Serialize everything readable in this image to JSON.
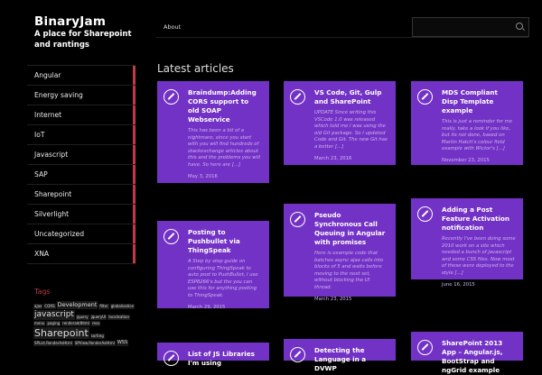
{
  "site": {
    "title": "BinaryJam",
    "tagline": "A place for Sharepoint and rantings"
  },
  "categories": [
    "Angular",
    "Energy saving",
    "Internet",
    "IoT",
    "Javascript",
    "SAP",
    "Sharepoint",
    "Silverlight",
    "Uncategorized",
    "XNA"
  ],
  "tags": {
    "heading": "Tags",
    "items": [
      {
        "label": "ajax",
        "size": "t1"
      },
      {
        "label": "CORS",
        "size": "t1"
      },
      {
        "label": "Development",
        "size": "t2"
      },
      {
        "label": "filter",
        "size": "t1"
      },
      {
        "label": "globalisation",
        "size": "t1"
      },
      {
        "label": "javascript",
        "size": "t3"
      },
      {
        "label": "jquery",
        "size": "t1"
      },
      {
        "label": "jqueryUI",
        "size": "t1"
      },
      {
        "label": "localisation",
        "size": "t1"
      },
      {
        "label": "menu",
        "size": "t1"
      },
      {
        "label": "paging",
        "size": "t1"
      },
      {
        "label": "renderaddhtml",
        "size": "t1"
      },
      {
        "label": "resx",
        "size": "t1"
      },
      {
        "label": "Sharepoint",
        "size": "t4"
      },
      {
        "label": "sorting",
        "size": "t1"
      },
      {
        "label": "SPList.RenderAsHtml",
        "size": "t1"
      },
      {
        "label": "SPView.RenderAsHtml",
        "size": "t1"
      },
      {
        "label": "WSS",
        "size": "t5"
      }
    ]
  },
  "nav": {
    "about": "About"
  },
  "search": {
    "placeholder": ""
  },
  "main": {
    "section_title": "Latest articles",
    "articles": [
      {
        "title": "Braindump:Adding CORS support to old SOAP Webservice",
        "excerpt": "This has been a bit of a nightmare, since you start with you will find hundreds of stackexchange articles about this and the problems you will have. So here are […]",
        "date": "May 3, 2016"
      },
      {
        "title": "VS Code, Git, Gulp and SharePoint",
        "excerpt": "UPDATE Since writing this VSCode 1.0 was released which told me I was using the old Git package. So I updated Code and Git. The new Git has a better […]",
        "date": "March 23, 2016"
      },
      {
        "title": "MDS Compliant Disp Template example",
        "excerpt": "This is just a reminder for me really, take a look if you like, but its not done, based on Martin Hatch's colour field example with Wictor's […]",
        "date": "November 23, 2015"
      },
      {
        "title": "Posting to Pushbullet via ThingSpeak",
        "excerpt": "A Step by step guide on configuring ThingSpeak to auto post to PushBullet, I use ESP8266's but the you can use this for anything posting to ThingSpeak.",
        "date": "March 29, 2015"
      },
      {
        "title": "Pseudo Synchronous Call Queuing in Angular with promises",
        "excerpt": "Here is example code that batches async ajax calls into blocks of 5 and waits before moving to the next set, without blocking the UI thread.",
        "date": "March 23, 2015"
      },
      {
        "title": "Adding a Post Feature Activation notification",
        "excerpt": "Recently I've been doing some 2010 work on a site which needed a bunch of javascript and some CSS files. Now most of these were deployed to the style […]",
        "date": "June 16, 2015"
      },
      {
        "title": "List of JS Libraries I'm using",
        "excerpt": "",
        "date": ""
      },
      {
        "title": "Detecting the Language in a DVWP",
        "excerpt": "",
        "date": ""
      },
      {
        "title": "SharePoint 2013 App – Angular.js, BootStrap and ngGrid example",
        "excerpt": "",
        "date": ""
      }
    ]
  }
}
